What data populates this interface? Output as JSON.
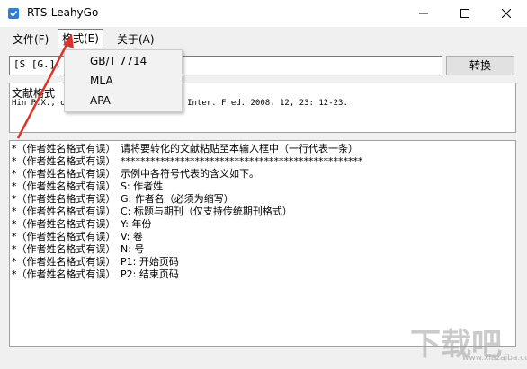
{
  "window": {
    "title": "RTS-LeahyGo"
  },
  "menu": {
    "items": [
      {
        "label": "文件(F)"
      },
      {
        "label": "格式(E)"
      },
      {
        "label": "关于(A)"
      }
    ],
    "dropdown": {
      "options": [
        "GB/T 7714",
        "MLA",
        "APA"
      ]
    }
  },
  "input": {
    "value": "[S [G.],"
  },
  "convert_button": {
    "label": "转换"
  },
  "output": {
    "label": "文献格式",
    "line": "Hin P.X.,                           o the communist cause. J. Inter. Fred. 2008, 12, 23: 12-23."
  },
  "help": {
    "lines": [
      "*（作者姓名格式有误）　请将要转化的文献粘贴至本输入框中（一行代表一条）",
      "*（作者姓名格式有误）　*************************************************",
      "*（作者姓名格式有误）　示例中各符号代表的含义如下。",
      "*（作者姓名格式有误）　S: 作者姓",
      "*（作者姓名格式有误）　G: 作者名（必须为缩写）",
      "*（作者姓名格式有误）　C: 标题与期刊（仅支持传统期刊格式）",
      "*（作者姓名格式有误）　Y: 年份",
      "*（作者姓名格式有误）　V: 卷",
      "*（作者姓名格式有误）　N: 号",
      "*（作者姓名格式有误）　P1: 开始页码",
      "*（作者姓名格式有误）　P2: 结束页码"
    ]
  },
  "watermark": {
    "text": "下载吧",
    "url": "www.xiazaiba.com"
  },
  "colors": {
    "arrow": "#d9342b",
    "title_bg": "#ffffff",
    "chrome_bg": "#f0f0f0"
  }
}
